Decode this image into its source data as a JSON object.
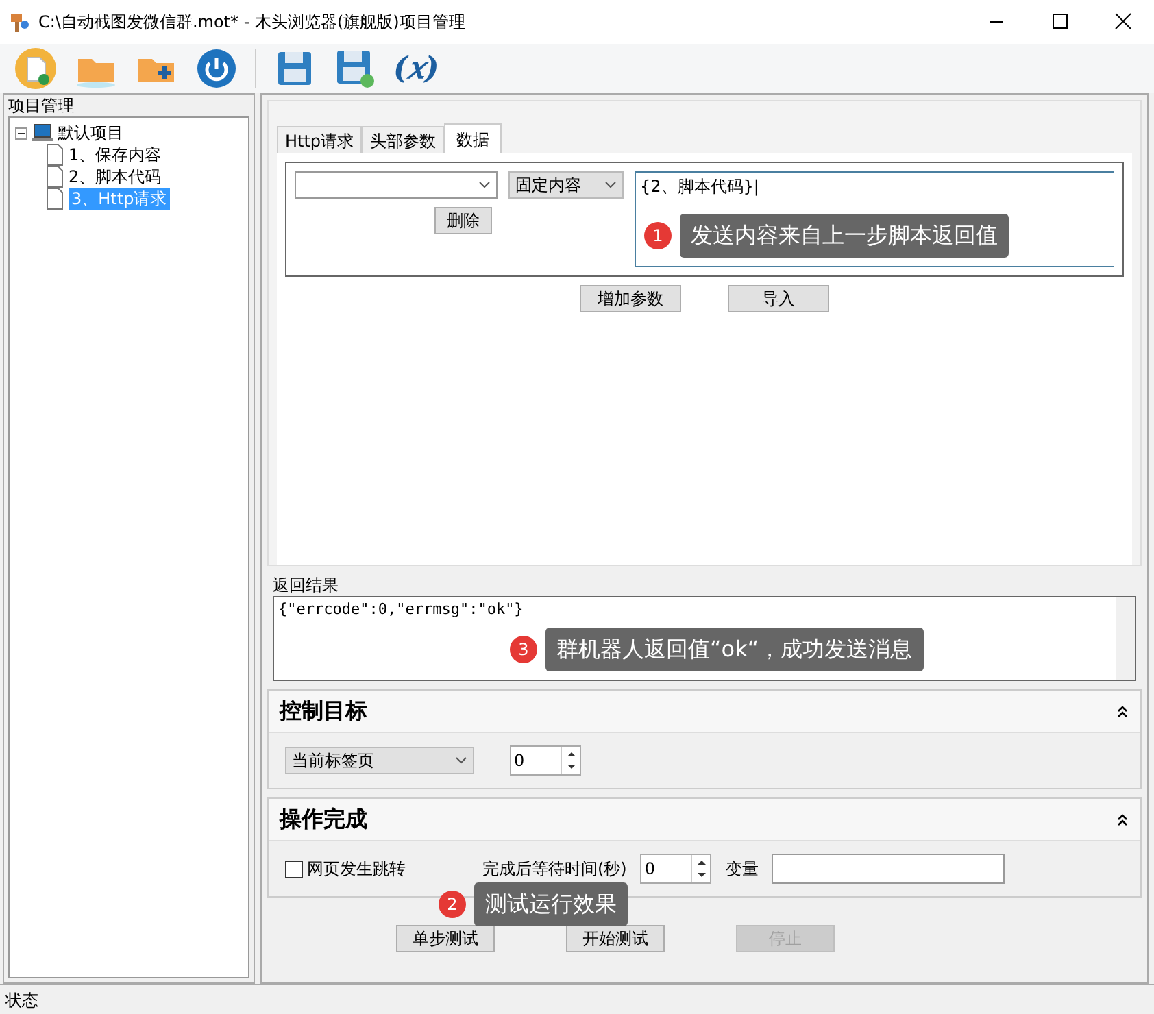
{
  "window": {
    "title": "C:\\自动截图发微信群.mot* - 木头浏览器(旗舰版)项目管理"
  },
  "toolbar": [
    {
      "kind": "new"
    },
    {
      "kind": "open"
    },
    {
      "kind": "add-folder"
    },
    {
      "kind": "power"
    },
    {
      "kind": "sep"
    },
    {
      "kind": "save"
    },
    {
      "kind": "save-as"
    },
    {
      "kind": "variable",
      "label": "(𝑥)"
    }
  ],
  "project_panel": {
    "title": "项目管理",
    "tree": [
      {
        "label": "默认项目",
        "expanded": true,
        "children": [
          {
            "label": "1、保存内容",
            "selected": false
          },
          {
            "label": "2、脚本代码",
            "selected": false
          },
          {
            "label": "3、Http请求",
            "selected": true
          }
        ]
      }
    ]
  },
  "tabs": [
    {
      "label": "Http请求",
      "selected": false
    },
    {
      "label": "头部参数",
      "selected": false
    },
    {
      "label": "数据",
      "selected": true
    }
  ],
  "data_param": {
    "source": "固定内容",
    "value": "{2、脚本代码}|",
    "delete_button": "删除"
  },
  "data_buttons": [
    "增加参数",
    "导入"
  ],
  "result": {
    "label": "返回结果",
    "text": "{\"errcode\":0,\"errmsg\":\"ok\"}"
  },
  "control_target": {
    "title": "控制目标",
    "expanded": true,
    "target": "当前标签页",
    "index": "0"
  },
  "operation_done": {
    "title": "操作完成",
    "expanded": true,
    "redirect": {
      "label": "网页发生跳转",
      "checked": false
    },
    "wait_label": "完成后等待时间(秒)",
    "wait_value": "0",
    "variable_label": "变量"
  },
  "actions": [
    {
      "label": "单步测试",
      "disabled": false
    },
    {
      "label": "开始测试",
      "disabled": false
    },
    {
      "label": "停止",
      "disabled": true
    }
  ],
  "status_bar": "状态",
  "annotations": [
    {
      "number": "1",
      "text": "发送内容来自上一步脚本返回值"
    },
    {
      "number": "2",
      "text": "测试运行效果"
    },
    {
      "number": "3",
      "text": "群机器人返回值“ok“，成功发送消息"
    }
  ]
}
